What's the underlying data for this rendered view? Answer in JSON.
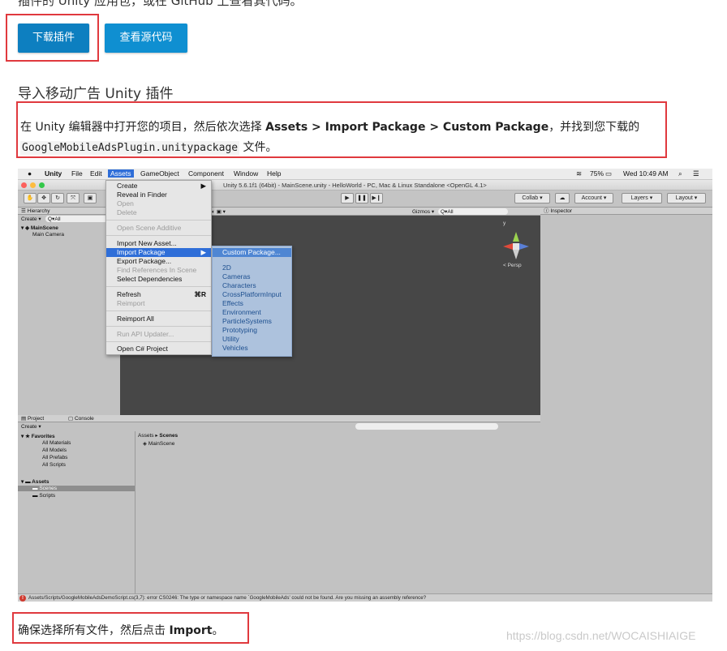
{
  "top_text": "插件的 Unity 应用包，或在 GitHub 上查看其代码。",
  "buttons": {
    "download": "下载插件",
    "source": "查看源代码"
  },
  "heading": "导入移动广告 Unity 插件",
  "instruction": {
    "prefix": "在 Unity 编辑器中打开您的项目，然后依次选择 ",
    "menu_path": "Assets > Import Package > Custom Package",
    "suffix": "，并找到您下载的",
    "file": "GoogleMobileAdsPlugin.unitypackage",
    "tail": " 文件。"
  },
  "unity": {
    "mac_menu": {
      "app": "Unity",
      "file": "File",
      "edit": "Edit",
      "assets": "Assets",
      "gameobject": "GameObject",
      "component": "Component",
      "window": "Window",
      "help": "Help"
    },
    "mac_status": {
      "battery": "75%",
      "time": "Wed 10:49 AM"
    },
    "window_title": "Unity 5.6.1f1 (64bit) - MainScene.unity - HelloWorld - PC, Mac & Linux Standalone <OpenGL 4.1>",
    "toolbar": {
      "collab": "Collab",
      "account": "Account",
      "layers": "Layers",
      "layout": "Layout"
    },
    "hierarchy": {
      "title": "Hierarchy",
      "create": "Create",
      "search": "Q▾All",
      "scene": "MainScene",
      "camera": "Main Camera"
    },
    "scene_view": {
      "gizmos": "Gizmos",
      "search": "Q▾All",
      "persp": "< Persp"
    },
    "inspector": {
      "title": "Inspector"
    },
    "assets_menu": [
      {
        "label": "Create",
        "state": "normal",
        "arrow": "▶"
      },
      {
        "label": "Reveal in Finder",
        "state": "normal"
      },
      {
        "label": "Open",
        "state": "disabled"
      },
      {
        "label": "Delete",
        "state": "disabled"
      },
      {
        "label": "Open Scene Additive",
        "state": "disabled"
      },
      {
        "label": "Import New Asset...",
        "state": "normal"
      },
      {
        "label": "Import Package",
        "state": "highlight",
        "arrow": "▶"
      },
      {
        "label": "Export Package...",
        "state": "normal"
      },
      {
        "label": "Find References In Scene",
        "state": "disabled"
      },
      {
        "label": "Select Dependencies",
        "state": "normal"
      },
      {
        "label": "Refresh",
        "state": "normal",
        "shortcut": "⌘R"
      },
      {
        "label": "Reimport",
        "state": "disabled"
      },
      {
        "label": "Reimport All",
        "state": "normal"
      },
      {
        "label": "Run API Updater...",
        "state": "disabled"
      },
      {
        "label": "Open C# Project",
        "state": "normal"
      }
    ],
    "import_submenu": [
      "Custom Package...",
      "2D",
      "Cameras",
      "Characters",
      "CrossPlatformInput",
      "Effects",
      "Environment",
      "ParticleSystems",
      "Prototyping",
      "Utility",
      "Vehicles"
    ],
    "project": {
      "tab_project": "Project",
      "tab_console": "Console",
      "create": "Create",
      "breadcrumb_root": "Assets",
      "breadcrumb_sep": "▸",
      "breadcrumb_leaf": "Scenes",
      "scene_file": "MainScene",
      "favorites": "Favorites",
      "favorite_items": [
        "All Materials",
        "All Models",
        "All Prefabs",
        "All Scripts"
      ],
      "assets": "Assets",
      "asset_folders": [
        "Scenes",
        "Scripts"
      ]
    },
    "status_error": "Assets/Scripts/GoogleMobileAdsDemoScript.cs(3,7): error CS0246: The type or namespace name `GoogleMobileAds' could not be found. Are you missing an assembly reference?"
  },
  "final": {
    "prefix": "确保选择所有文件，然后点击 ",
    "bold": "Import",
    "suffix": "。"
  },
  "watermark": "https://blog.csdn.net/WOCAISHIAIGE"
}
